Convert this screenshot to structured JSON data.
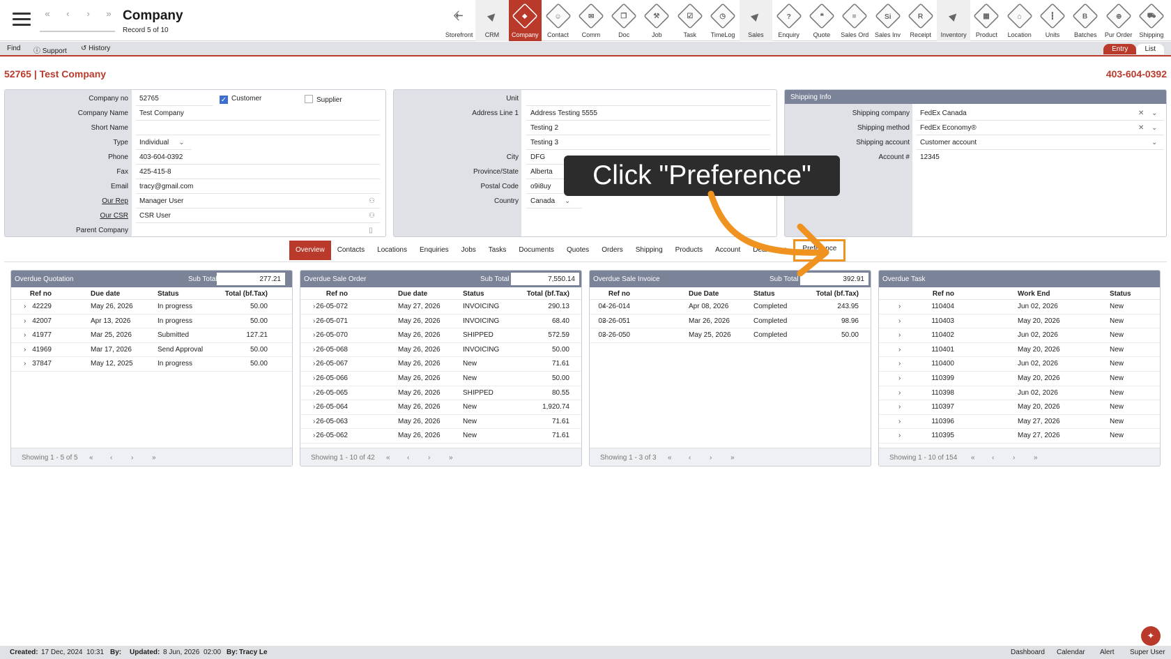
{
  "app": {
    "title": "Company",
    "record": "Record 5 of 10",
    "nav": [
      "«",
      "‹",
      "›",
      "»"
    ]
  },
  "modules": [
    {
      "label": "Storefront",
      "icon": "storefront-icon",
      "glyph": "⇱"
    },
    {
      "label": "CRM",
      "icon": "crm-arrow-icon",
      "glyph": "▶"
    },
    {
      "label": "Company",
      "icon": "company-icon",
      "glyph": "⬥"
    },
    {
      "label": "Contact",
      "icon": "contact-icon",
      "glyph": "☺"
    },
    {
      "label": "Comm",
      "icon": "comm-icon",
      "glyph": "✉"
    },
    {
      "label": "Doc",
      "icon": "doc-icon",
      "glyph": "❐"
    },
    {
      "label": "Job",
      "icon": "job-icon",
      "glyph": "⚒"
    },
    {
      "label": "Task",
      "icon": "task-icon",
      "glyph": "☑"
    },
    {
      "label": "TimeLog",
      "icon": "timelog-icon",
      "glyph": "◷"
    },
    {
      "label": "Sales",
      "icon": "sales-arrow-icon",
      "glyph": "▶"
    },
    {
      "label": "Enquiry",
      "icon": "enquiry-icon",
      "glyph": "?"
    },
    {
      "label": "Quote",
      "icon": "quote-icon",
      "glyph": "❝"
    },
    {
      "label": "Sales Ord",
      "icon": "sales-order-icon",
      "glyph": "≡"
    },
    {
      "label": "Sales Inv",
      "icon": "sales-invoice-icon",
      "glyph": "Si"
    },
    {
      "label": "Receipt",
      "icon": "receipt-icon",
      "glyph": "R"
    },
    {
      "label": "Inventory",
      "icon": "inventory-arrow-icon",
      "glyph": "▶"
    },
    {
      "label": "Product",
      "icon": "product-icon",
      "glyph": "▦"
    },
    {
      "label": "Location",
      "icon": "location-icon",
      "glyph": "⌂"
    },
    {
      "label": "Units",
      "icon": "units-icon",
      "glyph": "┇"
    },
    {
      "label": "Batches",
      "icon": "batches-icon",
      "glyph": "B"
    },
    {
      "label": "Pur Order",
      "icon": "purchase-order-icon",
      "glyph": "⊕"
    },
    {
      "label": "Shipping",
      "icon": "shipping-icon",
      "glyph": "⛟"
    }
  ],
  "toolbar": {
    "find": "Find",
    "support": "Support",
    "history": "History",
    "entry": "Entry",
    "list": "List"
  },
  "headline": {
    "left": "52765 | Test Company",
    "right": "403-604-0392"
  },
  "company_form": {
    "company_no_label": "Company no",
    "company_no": "52765",
    "customer_label": "Customer",
    "supplier_label": "Supplier",
    "name_label": "Company Name",
    "name": "Test Company",
    "short_label": "Short Name",
    "short": "",
    "type_label": "Type",
    "type": "Individual",
    "phone_label": "Phone",
    "phone": "403-604-0392",
    "fax_label": "Fax",
    "fax": "425-415-8",
    "email_label": "Email",
    "email": "tracy@gmail.com",
    "rep_label": "Our Rep",
    "rep": "Manager User",
    "csr_label": "Our CSR",
    "csr": "CSR User",
    "parent_label": "Parent Company",
    "parent": ""
  },
  "address_form": {
    "unit_label": "Unit",
    "unit": "",
    "line1_label": "Address Line 1",
    "line1": "Address Testing 5555",
    "line2": "Testing 2",
    "line3": "Testing 3",
    "city_label": "City",
    "city": "DFG",
    "province_label": "Province/State",
    "province": "Alberta",
    "postal_label": "Postal Code",
    "postal": "o9i8uy",
    "country_label": "Country",
    "country": "Canada"
  },
  "shipping_form": {
    "header": "Shipping Info",
    "company_label": "Shipping company",
    "company": "FedEx Canada",
    "method_label": "Shipping method",
    "method": "FedEx Economy®",
    "account_label": "Shipping account",
    "account": "Customer account",
    "acctno_label": "Account #",
    "acctno": "12345"
  },
  "tabs": [
    "Overview",
    "Contacts",
    "Locations",
    "Enquiries",
    "Jobs",
    "Tasks",
    "Documents",
    "Quotes",
    "Orders",
    "Shipping",
    "Products",
    "Account",
    "Deal",
    "gs",
    "Preference"
  ],
  "callout": "Click \"Preference\"",
  "grids": {
    "quotation": {
      "title": "Overdue Quotation",
      "subtotal_label": "Sub Total",
      "subtotal": "277.21",
      "cols": [
        "Ref no",
        "Due date",
        "Status",
        "Total (bf.Tax)"
      ],
      "rows": [
        [
          "42229",
          "May 26, 2026",
          "In progress",
          "50.00"
        ],
        [
          "42007",
          "Apr 13, 2026",
          "In progress",
          "50.00"
        ],
        [
          "41977",
          "Mar 25, 2026",
          "Submitted",
          "127.21"
        ],
        [
          "41969",
          "Mar 17, 2026",
          "Send Approval",
          "50.00"
        ],
        [
          "37847",
          "May 12, 2025",
          "In progress",
          "50.00"
        ]
      ],
      "footer": "Showing 1 - 5 of 5"
    },
    "sale_order": {
      "title": "Overdue Sale Order",
      "subtotal_label": "Sub Total",
      "subtotal": "7,550.14",
      "cols": [
        "Ref no",
        "Due date",
        "Status",
        "Total (bf.Tax)"
      ],
      "rows": [
        [
          "26-05-072",
          "May 27, 2026",
          "INVOICING",
          "290.13"
        ],
        [
          "26-05-071",
          "May 26, 2026",
          "INVOICING",
          "68.40"
        ],
        [
          "26-05-070",
          "May 26, 2026",
          "SHIPPED",
          "572.59"
        ],
        [
          "26-05-068",
          "May 26, 2026",
          "INVOICING",
          "50.00"
        ],
        [
          "26-05-067",
          "May 26, 2026",
          "New",
          "71.61"
        ],
        [
          "26-05-066",
          "May 26, 2026",
          "New",
          "50.00"
        ],
        [
          "26-05-065",
          "May 26, 2026",
          "SHIPPED",
          "80.55"
        ],
        [
          "26-05-064",
          "May 26, 2026",
          "New",
          "1,920.74"
        ],
        [
          "26-05-063",
          "May 26, 2026",
          "New",
          "71.61"
        ],
        [
          "26-05-062",
          "May 26, 2026",
          "New",
          "71.61"
        ]
      ],
      "footer": "Showing 1 - 10 of 42"
    },
    "sale_invoice": {
      "title": "Overdue Sale Invoice",
      "subtotal_label": "Sub Total",
      "subtotal": "392.91",
      "cols": [
        "Ref no",
        "Due Date",
        "Status",
        "Total (bf.Tax)"
      ],
      "rows": [
        [
          "04-26-014",
          "Apr 08, 2026",
          "Completed",
          "243.95"
        ],
        [
          "03-26-051",
          "Mar 26, 2026",
          "Completed",
          "98.96"
        ],
        [
          "03-26-050",
          "May 25, 2026",
          "Completed",
          "50.00"
        ]
      ],
      "footer": "Showing 1 - 3 of 3"
    },
    "task": {
      "title": "Overdue Task",
      "cols": [
        "Ref no",
        "Work End",
        "Status"
      ],
      "rows": [
        [
          "110404",
          "Jun 02, 2026",
          "New"
        ],
        [
          "110403",
          "May 20, 2026",
          "New"
        ],
        [
          "110402",
          "Jun 02, 2026",
          "New"
        ],
        [
          "110401",
          "May 20, 2026",
          "New"
        ],
        [
          "110400",
          "Jun 02, 2026",
          "New"
        ],
        [
          "110399",
          "May 20, 2026",
          "New"
        ],
        [
          "110398",
          "Jun 02, 2026",
          "New"
        ],
        [
          "110397",
          "May 20, 2026",
          "New"
        ],
        [
          "110396",
          "May 27, 2026",
          "New"
        ],
        [
          "110395",
          "May 27, 2026",
          "New"
        ]
      ],
      "footer": "Showing 1 - 10 of 154"
    },
    "pager": [
      "«",
      "‹",
      "›",
      "»"
    ]
  },
  "footer": {
    "created_label": "Created:",
    "created": "17 Dec, 2024",
    "created_time": "10:31",
    "by_label": "By:",
    "updated_label": "Updated:",
    "updated": "8 Jun, 2026",
    "updated_time": "02:00",
    "by2_label": "By:",
    "by2": "Tracy Le",
    "links": [
      "Dashboard",
      "Calendar",
      "Alert",
      "Super User"
    ]
  },
  "colors": {
    "accent": "#b93a2b",
    "panel_header": "#7a8397",
    "highlight": "#f0921f"
  }
}
